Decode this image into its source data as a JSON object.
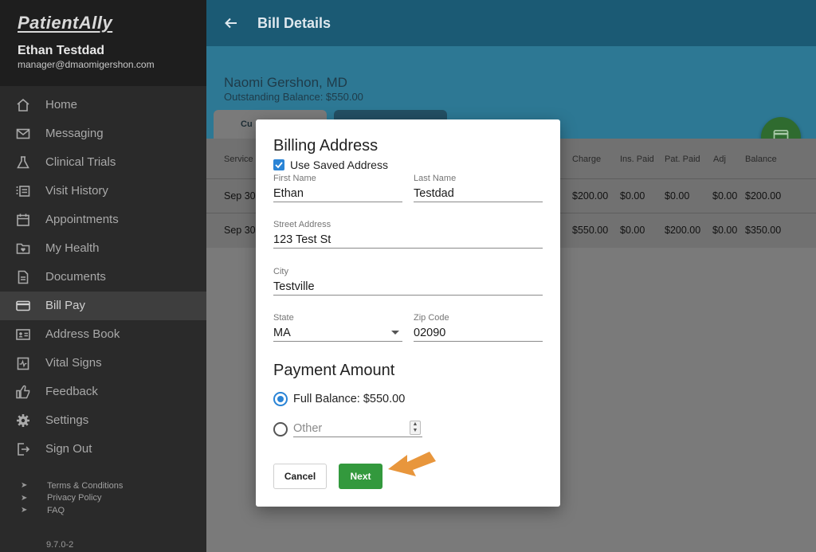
{
  "app": {
    "logo": "PatientAlly",
    "version": "9.7.0-2"
  },
  "user": {
    "name": "Ethan Testdad",
    "email": "manager@dmaomigershon.com"
  },
  "sidebar": {
    "items": [
      {
        "label": "Home",
        "icon": "home-icon"
      },
      {
        "label": "Messaging",
        "icon": "mail-icon"
      },
      {
        "label": "Clinical Trials",
        "icon": "flask-icon"
      },
      {
        "label": "Visit History",
        "icon": "list-icon"
      },
      {
        "label": "Appointments",
        "icon": "calendar-icon"
      },
      {
        "label": "My Health",
        "icon": "folder-heart-icon"
      },
      {
        "label": "Documents",
        "icon": "document-icon"
      },
      {
        "label": "Bill Pay",
        "icon": "credit-card-icon",
        "active": true
      },
      {
        "label": "Address Book",
        "icon": "contact-card-icon"
      },
      {
        "label": "Vital Signs",
        "icon": "clipboard-pulse-icon"
      },
      {
        "label": "Feedback",
        "icon": "thumbs-up-icon"
      },
      {
        "label": "Settings",
        "icon": "gear-icon"
      },
      {
        "label": "Sign Out",
        "icon": "sign-out-icon"
      }
    ],
    "links": [
      "Terms & Conditions",
      "Privacy Policy",
      "FAQ"
    ]
  },
  "header": {
    "title": "Bill Details"
  },
  "provider": {
    "name": "Naomi Gershon, MD",
    "outstanding": "Outstanding Balance: $550.00"
  },
  "tabs": {
    "current": "Cu"
  },
  "table": {
    "headers": {
      "service": "Service I",
      "charge": "Charge",
      "ins_paid": "Ins. Paid",
      "pat_paid": "Pat. Paid",
      "adj": "Adj",
      "balance": "Balance"
    },
    "rows": [
      {
        "date": "Sep 30,",
        "charge": "$200.00",
        "ins_paid": "$0.00",
        "pat_paid": "$0.00",
        "adj": "$0.00",
        "balance": "$200.00"
      },
      {
        "date": "Sep 30,",
        "charge": "$550.00",
        "ins_paid": "$0.00",
        "pat_paid": "$200.00",
        "adj": "$0.00",
        "balance": "$350.00"
      }
    ]
  },
  "modal": {
    "title": "Billing Address",
    "use_saved_label": "Use Saved Address",
    "first_name": {
      "label": "First Name",
      "value": "Ethan"
    },
    "last_name": {
      "label": "Last Name",
      "value": "Testdad"
    },
    "street": {
      "label": "Street Address",
      "value": "123 Test St"
    },
    "city": {
      "label": "City",
      "value": "Testville"
    },
    "state": {
      "label": "State",
      "value": "MA"
    },
    "zip": {
      "label": "Zip Code",
      "value": "02090"
    },
    "payment_title": "Payment Amount",
    "full_balance_label": "Full Balance: $550.00",
    "other_placeholder": "Other",
    "cancel_label": "Cancel",
    "next_label": "Next"
  },
  "colors": {
    "topbar": "#1b5a74",
    "accent_blue": "#2a84d6",
    "next_green": "#33993d",
    "pointer_orange": "#e8963c"
  }
}
